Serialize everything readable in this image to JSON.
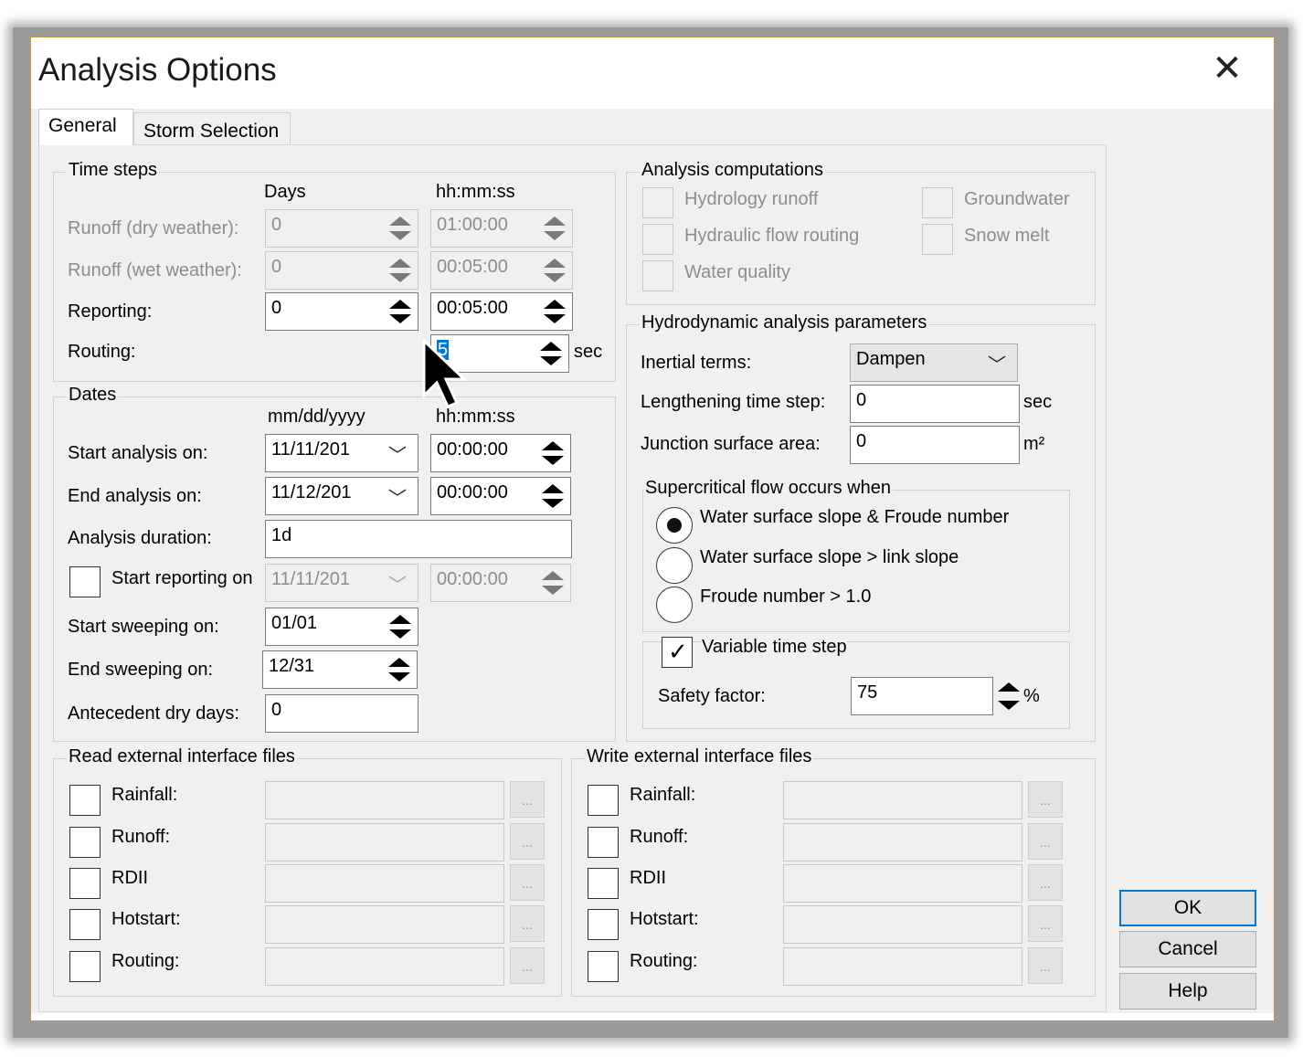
{
  "window": {
    "title": "Analysis Options"
  },
  "tabs": [
    {
      "label": "General"
    },
    {
      "label": "Storm Selection"
    }
  ],
  "time_steps": {
    "legend": "Time steps",
    "col_days": "Days",
    "col_time": "hh:mm:ss",
    "runoff_dry": {
      "label": "Runoff (dry weather):",
      "days": "0",
      "time": "01:00:00"
    },
    "runoff_wet": {
      "label": "Runoff (wet weather):",
      "days": "0",
      "time": "00:05:00"
    },
    "reporting": {
      "label": "Reporting:",
      "days": "0",
      "time": "00:05:00"
    },
    "routing": {
      "label": "Routing:",
      "value": "5",
      "unit": "sec"
    }
  },
  "dates": {
    "legend": "Dates",
    "col_date": "mm/dd/yyyy",
    "col_time": "hh:mm:ss",
    "start_analysis": {
      "label": "Start analysis on:",
      "date": "11/11/201",
      "time": "00:00:00"
    },
    "end_analysis": {
      "label": "End analysis on:",
      "date": "11/12/201",
      "time": "00:00:00"
    },
    "duration": {
      "label": "Analysis duration:",
      "value": "1d"
    },
    "start_reporting": {
      "label": "Start reporting on",
      "date": "11/11/201",
      "time": "00:00:00"
    },
    "start_sweeping": {
      "label": "Start sweeping on:",
      "value": "01/01"
    },
    "end_sweeping": {
      "label": "End sweeping on:",
      "value": "12/31"
    },
    "antecedent": {
      "label": "Antecedent dry days:",
      "value": "0"
    }
  },
  "computations": {
    "legend": "Analysis computations",
    "hydrology": "Hydrology runoff",
    "hydraulic": "Hydraulic flow routing",
    "water_quality": "Water quality",
    "groundwater": "Groundwater",
    "snow": "Snow melt"
  },
  "hydrodynamic": {
    "legend": "Hydrodynamic analysis parameters",
    "inertial_label": "Inertial terms:",
    "inertial_value": "Dampen",
    "lengthening_label": "Lengthening time step:",
    "lengthening_value": "0",
    "lengthening_unit": "sec",
    "junction_label": "Junction surface area:",
    "junction_value": "0",
    "junction_unit": "m²",
    "supercritical_legend": "Supercritical flow occurs when",
    "radio_1": "Water surface slope & Froude number",
    "radio_2": "Water surface slope > link slope",
    "radio_3": "Froude number > 1.0",
    "variable_label": "Variable time step",
    "safety_label": "Safety factor:",
    "safety_value": "75",
    "safety_unit": "%"
  },
  "read_files": {
    "legend": "Read external interface files",
    "items": [
      "Rainfall:",
      "Runoff:",
      "RDII",
      "Hotstart:",
      "Routing:"
    ]
  },
  "write_files": {
    "legend": "Write external interface files",
    "items": [
      "Rainfall:",
      "Runoff:",
      "RDII",
      "Hotstart:",
      "Routing:"
    ]
  },
  "browse_label": "...",
  "buttons": {
    "ok": "OK",
    "cancel": "Cancel",
    "help": "Help"
  }
}
